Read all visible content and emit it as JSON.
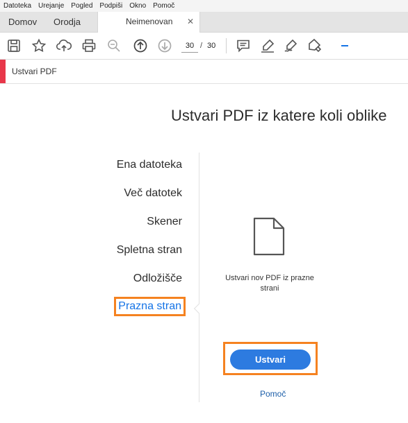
{
  "menu": [
    "Datoteka",
    "Urejanje",
    "Pogled",
    "Podpiši",
    "Okno",
    "Pomoč"
  ],
  "tabs": {
    "home": "Domov",
    "tools": "Orodja",
    "document": "Neimenovan",
    "close": "✕"
  },
  "toolbar": {
    "icons": [
      "save-icon",
      "bookmark-star-icon",
      "cloud-upload-icon",
      "print-icon",
      "zoom-out-icon",
      "page-up-icon",
      "page-down-icon",
      "comment-icon",
      "highlight-icon",
      "sign-icon",
      "edit-icon",
      "minus-icon"
    ],
    "page_current": "30",
    "page_separator": "/",
    "page_total": "30"
  },
  "panel": {
    "title": "Ustvari PDF"
  },
  "main": {
    "heading": "Ustvari PDF iz katere koli oblike",
    "options": [
      "Ena datoteka",
      "Več datotek",
      "Skener",
      "Spletna stran",
      "Odložišče",
      "Prazna stran"
    ],
    "selected_index": 5,
    "description": "Ustvari nov PDF iz prazne strani",
    "create_label": "Ustvari",
    "help_label": "Pomoč"
  },
  "colors": {
    "accent_red": "#e8374a",
    "button_blue": "#2d7be0",
    "link_blue": "#1473e6",
    "highlight_orange": "#f58220"
  }
}
